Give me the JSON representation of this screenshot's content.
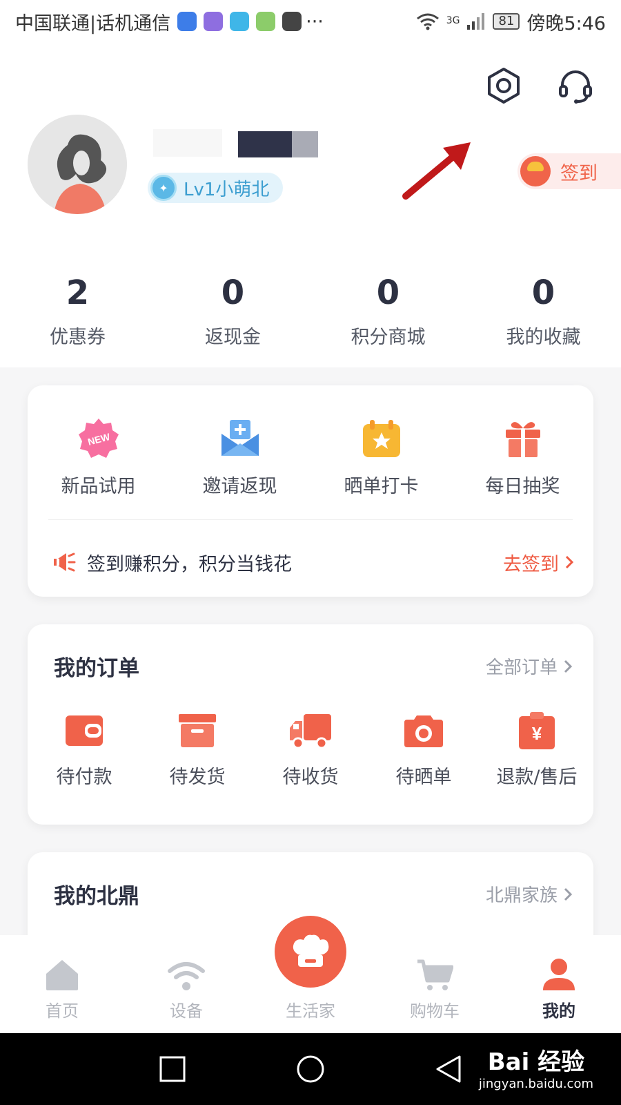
{
  "status_bar": {
    "carrier": "中国联通|话机通信",
    "more": "···",
    "network": "3G",
    "battery": "81",
    "time": "傍晚5:46"
  },
  "profile": {
    "level": "Lv1小萌北",
    "signin_label": "签到"
  },
  "stats": [
    {
      "value": "2",
      "label": "优惠券"
    },
    {
      "value": "0",
      "label": "返现金"
    },
    {
      "value": "0",
      "label": "积分商城"
    },
    {
      "value": "0",
      "label": "我的收藏"
    }
  ],
  "features": [
    {
      "label": "新品试用",
      "badge": "NEW"
    },
    {
      "label": "邀请返现"
    },
    {
      "label": "晒单打卡"
    },
    {
      "label": "每日抽奖"
    }
  ],
  "promo": {
    "text": "签到赚积分，积分当钱花",
    "link": "去签到"
  },
  "orders": {
    "title": "我的订单",
    "more": "全部订单",
    "items": [
      {
        "label": "待付款"
      },
      {
        "label": "待发货"
      },
      {
        "label": "待收货"
      },
      {
        "label": "待晒单"
      },
      {
        "label": "退款/售后",
        "icon_text": "¥"
      }
    ]
  },
  "beiding": {
    "title": "我的北鼎",
    "more": "北鼎家族"
  },
  "tabs": [
    {
      "label": "首页"
    },
    {
      "label": "设备"
    },
    {
      "label": "生活家"
    },
    {
      "label": "购物车"
    },
    {
      "label": "我的"
    }
  ],
  "watermark": {
    "brand": "Bai 经验",
    "url": "jingyan.baidu.com"
  },
  "colors": {
    "accent": "#f0624a",
    "level_text": "#3c9ed0",
    "text_dark": "#2d3142",
    "arrow": "#c0191a"
  }
}
